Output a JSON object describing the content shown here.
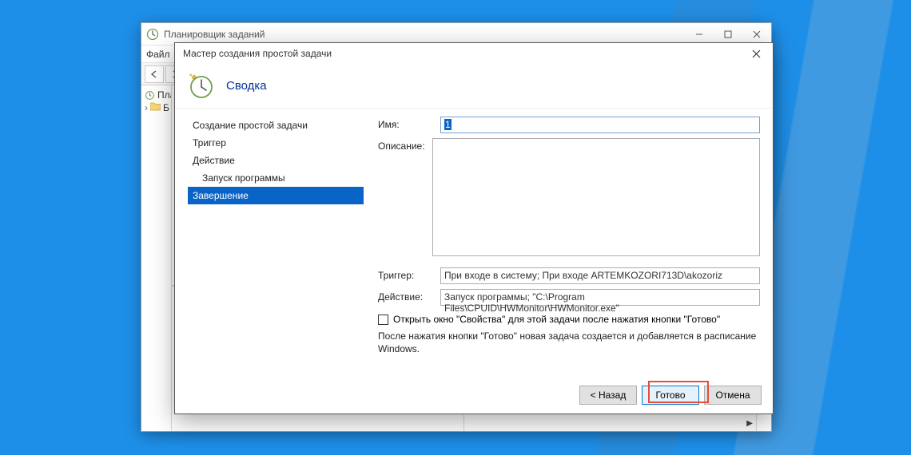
{
  "scheduler": {
    "title": "Планировщик заданий",
    "menu": {
      "file": "Файл"
    },
    "tree": {
      "root": "План",
      "child": "Б"
    }
  },
  "wizard": {
    "window_title": "Мастер создания простой задачи",
    "header_title": "Сводка",
    "steps": {
      "create": "Создание простой задачи",
      "trigger": "Триггер",
      "action": "Действие",
      "run_program": "Запуск программы",
      "finish": "Завершение"
    },
    "form": {
      "name_label": "Имя:",
      "name_value": "1",
      "desc_label": "Описание:",
      "desc_value": "",
      "trigger_label": "Триггер:",
      "trigger_value": "При входе в систему; При входе ARTEMKOZORI713D\\akozoriz",
      "action_label": "Действие:",
      "action_value": "Запуск программы; \"C:\\Program Files\\CPUID\\HWMonitor\\HWMonitor.exe\"",
      "open_props_label": "Открыть окно \"Свойства\" для этой задачи после нажатия кнопки \"Готово\"",
      "hint": "После нажатия кнопки \"Готово\" новая задача создается и добавляется в расписание Windows."
    },
    "buttons": {
      "back": "< Назад",
      "finish": "Готово",
      "cancel": "Отмена"
    }
  }
}
